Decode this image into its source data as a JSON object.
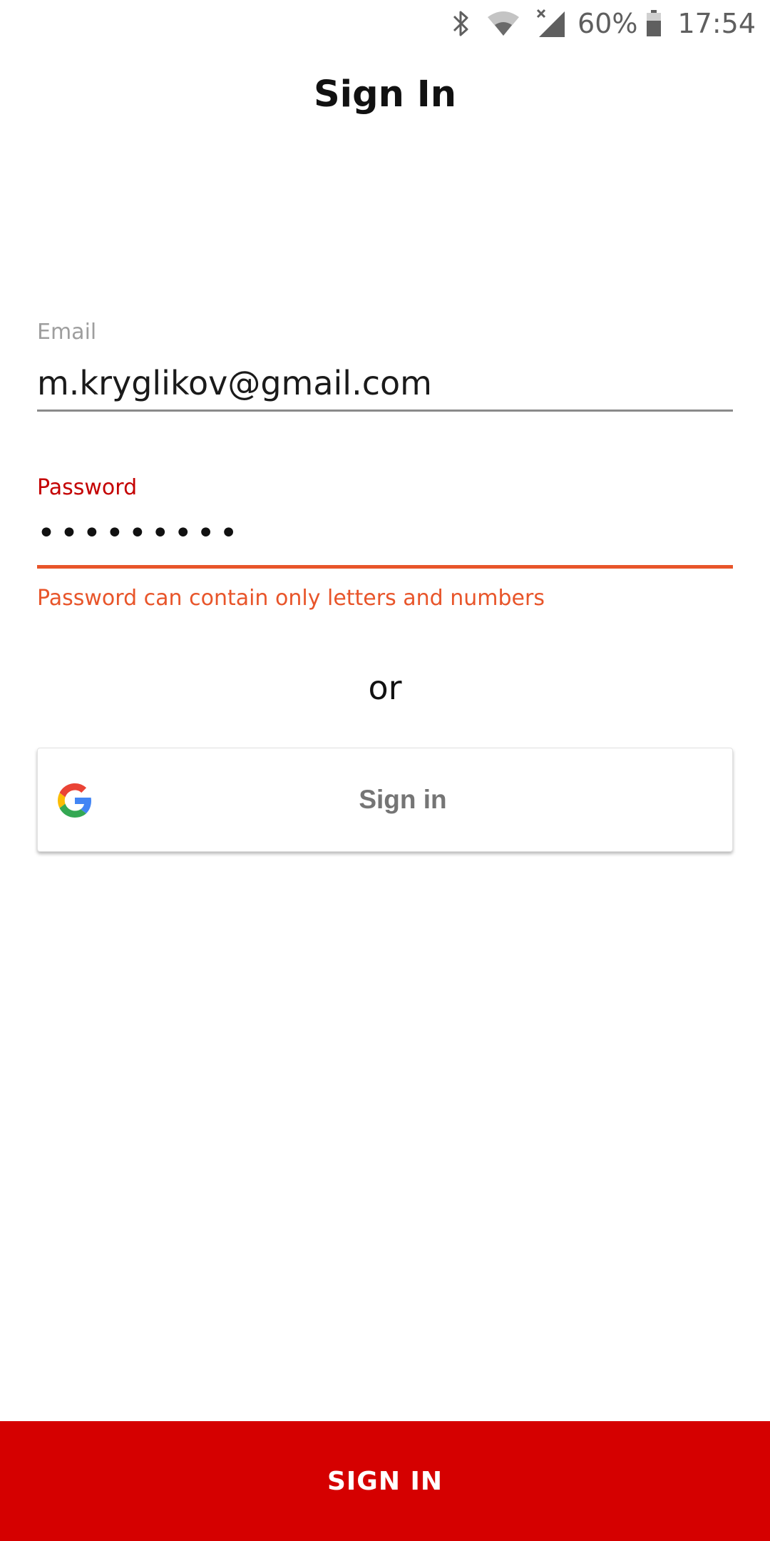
{
  "status_bar": {
    "battery_percent": "60%",
    "time": "17:54",
    "icons": [
      "bluetooth-icon",
      "wifi-icon",
      "signal-icon",
      "battery-icon"
    ]
  },
  "header": {
    "title": "Sign In"
  },
  "form": {
    "email": {
      "label": "Email",
      "value": "m.kryglikov@gmail.com"
    },
    "password": {
      "label": "Password",
      "value": "•••••••••",
      "error": "Password can contain only letters and numbers"
    }
  },
  "divider": {
    "text": "or"
  },
  "google_button": {
    "label": "Sign in",
    "icon": "google-icon"
  },
  "primary_button": {
    "label": "SIGN IN"
  },
  "colors": {
    "accent": "#d50000",
    "error": "#e8552a",
    "label_active": "#c40000"
  }
}
